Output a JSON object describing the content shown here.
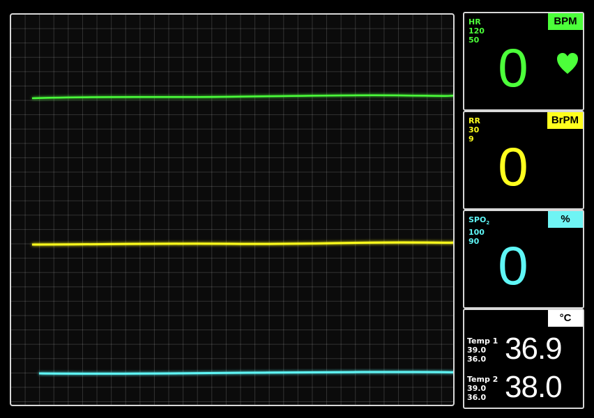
{
  "colors": {
    "hr": "#4cff3a",
    "rr": "#ffff1e",
    "spo2": "#5ff6f6",
    "temp": "#ffffff",
    "background": "#000000",
    "grid": "#3a3a3a"
  },
  "heart_rate": {
    "label": "HR",
    "upper_limit": "120",
    "lower_limit": "50",
    "value": "0",
    "unit": "BPM",
    "icon": "heart-icon"
  },
  "resp_rate": {
    "label": "RR",
    "upper_limit": "30",
    "lower_limit": "9",
    "value": "0",
    "unit": "BrPM"
  },
  "spo2": {
    "label": "SPO",
    "label_sub": "2",
    "upper_limit": "100",
    "lower_limit": "90",
    "value": "0",
    "unit": "%"
  },
  "temperature": {
    "unit": "°C",
    "sensors": [
      {
        "label": "Temp 1",
        "upper_limit": "39.0",
        "lower_limit": "36.0",
        "value": "36.9"
      },
      {
        "label": "Temp 2",
        "upper_limit": "39.0",
        "lower_limit": "36.0",
        "value": "38.0"
      }
    ]
  }
}
